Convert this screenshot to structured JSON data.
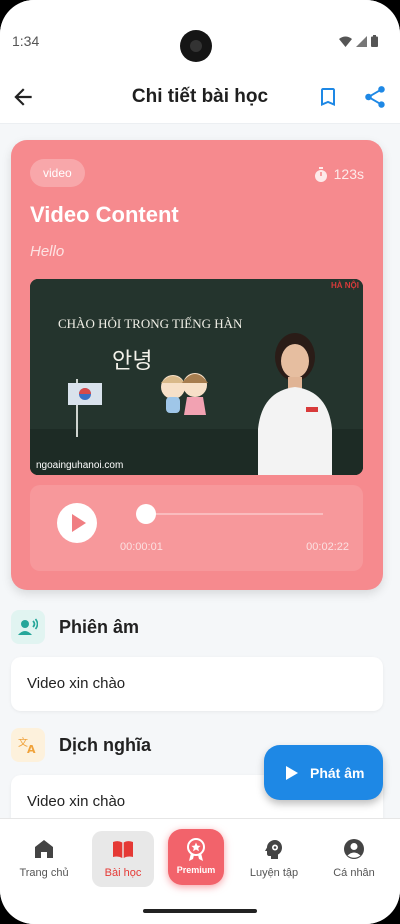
{
  "status_bar": {
    "time": "1:34"
  },
  "app_bar": {
    "title": "Chi tiết bài học"
  },
  "lesson": {
    "tag": "video",
    "duration": "123s",
    "title": "Video Content",
    "subtitle": "Hello",
    "thumbnail": {
      "board_text": "CHÀO HỎI TRONG TIẾNG HÀN",
      "korean_text": "안녕",
      "website": "ngoainguhanoi.com",
      "brand": "HÀ NỘI"
    },
    "player": {
      "current_time": "00:00:01",
      "total_time": "00:02:22",
      "progress": 0.007
    }
  },
  "sections": [
    {
      "title": "Phiên âm",
      "content": "Video xin chào",
      "icon": "pronunciation-icon"
    },
    {
      "title": "Dịch nghĩa",
      "content": "Video xin chào",
      "icon": "translate-icon"
    }
  ],
  "fab": {
    "label": "Phát âm"
  },
  "bottom_nav": {
    "items": [
      {
        "label": "Trang chủ",
        "icon": "home-icon"
      },
      {
        "label": "Bài học",
        "icon": "book-icon",
        "active": true
      },
      {
        "label": "Premium",
        "icon": "premium-icon"
      },
      {
        "label": "Luyện tập",
        "icon": "practice-icon"
      },
      {
        "label": "Cá nhân",
        "icon": "profile-icon"
      }
    ]
  },
  "colors": {
    "card": "#f68a8e",
    "primary": "#1e88e5",
    "active_nav": "#e53935",
    "premium": "#f2636b"
  }
}
